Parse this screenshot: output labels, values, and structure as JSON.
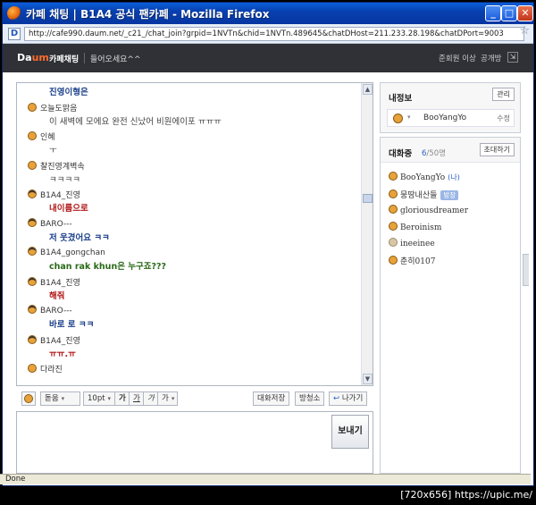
{
  "window": {
    "title": "카페 채팅 | B1A4 공식 팬카페 - Mozilla Firefox",
    "minimize": "_",
    "maximize": "□",
    "close": "✕"
  },
  "address": {
    "url": "http://cafe990.daum.net/_c21_/chat_join?grpid=1NVTn&chid=1NVTn.489645&chatDHost=211.233.28.198&chatDPort=9003"
  },
  "header": {
    "logo_da": "Da",
    "logo_um": "um",
    "cafe_chat": "카페채팅",
    "welcome": "들어오세요^^",
    "member_level": "준회원 이상",
    "public_room": "공개방"
  },
  "chat": {
    "messages": [
      {
        "user": "",
        "text": "진영이형은",
        "style": "blue"
      },
      {
        "user": "오늘도맑음",
        "text": "이 새벽에 모에요 완전 신났어 비원에이포 ㅠㅠㅠ",
        "style": "plain"
      },
      {
        "user": "인혜",
        "text": "ㅜ",
        "style": "plain"
      },
      {
        "user": "찰진영계벽속",
        "text": "ㅋㅋㅋㅋ",
        "style": "plain"
      },
      {
        "user": "B1A4_진영",
        "text": "내이름으로",
        "style": "red"
      },
      {
        "user": "BARO---",
        "text": "저 웃겼어요 ㅋㅋ",
        "style": "blue"
      },
      {
        "user": "B1A4_gongchan",
        "text": "chan rak khun은 누구죠???",
        "style": "green"
      },
      {
        "user": "B1A4_진영",
        "text": "해줘",
        "style": "red"
      },
      {
        "user": "BARO---",
        "text": "바로 로 ㅋㅋ",
        "style": "blue"
      },
      {
        "user": "B1A4_진영",
        "text": "ㅠㅠ.ㅠ",
        "style": "red"
      },
      {
        "user": "다라진",
        "text": "",
        "style": "plain"
      }
    ]
  },
  "toolbar": {
    "font": "돋움",
    "size": "10pt",
    "bold": "가",
    "underline": "가",
    "italic": "가",
    "color": "가",
    "save_chat": "대화저장",
    "broadcast": "방청소",
    "leave": "나가기"
  },
  "send": {
    "label": "보내기"
  },
  "myinfo": {
    "title": "내정보",
    "manage": "관리",
    "name": "BooYangYo",
    "edit": "수정"
  },
  "talking": {
    "title": "대화중",
    "count_current": "6",
    "count_max": "/50명",
    "invite": "초대하기",
    "users": [
      {
        "name": "BooYangYo",
        "tag": "(나)",
        "badge": ""
      },
      {
        "name": "뭉땅내산들",
        "tag": "",
        "badge": "방장"
      },
      {
        "name": "gloriousdreamer",
        "tag": "",
        "badge": ""
      },
      {
        "name": "Beroinism",
        "tag": "",
        "badge": ""
      },
      {
        "name": "ineeinee",
        "tag": "",
        "badge": ""
      },
      {
        "name": "춘히0107",
        "tag": "",
        "badge": ""
      }
    ]
  },
  "status": {
    "text": "Done"
  },
  "watermark": "[720x656] https://upic.me/"
}
